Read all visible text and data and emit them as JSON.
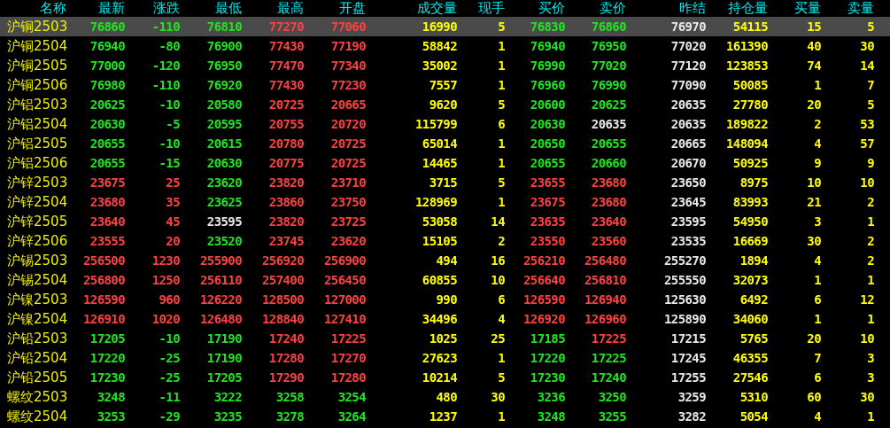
{
  "columns": [
    {
      "label": "名称",
      "kind": "name"
    },
    {
      "label": "最新",
      "kind": "price"
    },
    {
      "label": "涨跌",
      "kind": "price"
    },
    {
      "label": "最低",
      "kind": "price"
    },
    {
      "label": "最高",
      "kind": "price"
    },
    {
      "label": "开盘",
      "kind": "price"
    },
    {
      "label": "成交量",
      "kind": "volume"
    },
    {
      "label": "现手",
      "kind": "volume"
    },
    {
      "label": "买价",
      "kind": "price"
    },
    {
      "label": "卖价",
      "kind": "price"
    },
    {
      "label": "昨结",
      "kind": "settle"
    },
    {
      "label": "持仓量",
      "kind": "volume"
    },
    {
      "label": "买量",
      "kind": "volume"
    },
    {
      "label": "卖量",
      "kind": "volume"
    }
  ],
  "rows": [
    {
      "name": "沪铜2503",
      "selected": true,
      "cells": [
        {
          "text": "76860",
          "rising": false,
          "falling": true
        },
        {
          "text": "-110",
          "rising": false,
          "falling": true
        },
        {
          "text": "76810",
          "rising": false,
          "falling": true
        },
        {
          "text": "77270",
          "rising": true,
          "falling": false
        },
        {
          "text": "77060",
          "rising": true,
          "falling": false
        },
        {
          "text": "16990"
        },
        {
          "text": "5"
        },
        {
          "text": "76830",
          "rising": false,
          "falling": true
        },
        {
          "text": "76860",
          "rising": false,
          "falling": true
        },
        {
          "text": "76970"
        },
        {
          "text": "54115"
        },
        {
          "text": "15"
        },
        {
          "text": "5"
        }
      ]
    },
    {
      "name": "沪铜2504",
      "selected": false,
      "cells": [
        {
          "text": "76940",
          "rising": false,
          "falling": true
        },
        {
          "text": "-80",
          "rising": false,
          "falling": true
        },
        {
          "text": "76900",
          "rising": false,
          "falling": true
        },
        {
          "text": "77430",
          "rising": true,
          "falling": false
        },
        {
          "text": "77190",
          "rising": true,
          "falling": false
        },
        {
          "text": "58842"
        },
        {
          "text": "1"
        },
        {
          "text": "76940",
          "rising": false,
          "falling": true
        },
        {
          "text": "76950",
          "rising": false,
          "falling": true
        },
        {
          "text": "77020"
        },
        {
          "text": "161390"
        },
        {
          "text": "40"
        },
        {
          "text": "30"
        }
      ]
    },
    {
      "name": "沪铜2505",
      "selected": false,
      "cells": [
        {
          "text": "77000",
          "rising": false,
          "falling": true
        },
        {
          "text": "-120",
          "rising": false,
          "falling": true
        },
        {
          "text": "76950",
          "rising": false,
          "falling": true
        },
        {
          "text": "77470",
          "rising": true,
          "falling": false
        },
        {
          "text": "77340",
          "rising": true,
          "falling": false
        },
        {
          "text": "35002"
        },
        {
          "text": "1"
        },
        {
          "text": "76990",
          "rising": false,
          "falling": true
        },
        {
          "text": "77020",
          "rising": false,
          "falling": true
        },
        {
          "text": "77120"
        },
        {
          "text": "123853"
        },
        {
          "text": "74"
        },
        {
          "text": "14"
        }
      ]
    },
    {
      "name": "沪铜2506",
      "selected": false,
      "cells": [
        {
          "text": "76980",
          "rising": false,
          "falling": true
        },
        {
          "text": "-110",
          "rising": false,
          "falling": true
        },
        {
          "text": "76920",
          "rising": false,
          "falling": true
        },
        {
          "text": "77430",
          "rising": true,
          "falling": false
        },
        {
          "text": "77230",
          "rising": true,
          "falling": false
        },
        {
          "text": "7557"
        },
        {
          "text": "1"
        },
        {
          "text": "76960",
          "rising": false,
          "falling": true
        },
        {
          "text": "76990",
          "rising": false,
          "falling": true
        },
        {
          "text": "77090"
        },
        {
          "text": "50085"
        },
        {
          "text": "1"
        },
        {
          "text": "7"
        }
      ]
    },
    {
      "name": "沪铝2503",
      "selected": false,
      "cells": [
        {
          "text": "20625",
          "rising": false,
          "falling": true
        },
        {
          "text": "-10",
          "rising": false,
          "falling": true
        },
        {
          "text": "20580",
          "rising": false,
          "falling": true
        },
        {
          "text": "20725",
          "rising": true,
          "falling": false
        },
        {
          "text": "20665",
          "rising": true,
          "falling": false
        },
        {
          "text": "9620"
        },
        {
          "text": "5"
        },
        {
          "text": "20600",
          "rising": false,
          "falling": true
        },
        {
          "text": "20625",
          "rising": false,
          "falling": true
        },
        {
          "text": "20635"
        },
        {
          "text": "27780"
        },
        {
          "text": "20"
        },
        {
          "text": "5"
        }
      ]
    },
    {
      "name": "沪铝2504",
      "selected": false,
      "cells": [
        {
          "text": "20630",
          "rising": false,
          "falling": true
        },
        {
          "text": "-5",
          "rising": false,
          "falling": true
        },
        {
          "text": "20595",
          "rising": false,
          "falling": true
        },
        {
          "text": "20755",
          "rising": true,
          "falling": false
        },
        {
          "text": "20720",
          "rising": true,
          "falling": false
        },
        {
          "text": "115799"
        },
        {
          "text": "6"
        },
        {
          "text": "20630",
          "rising": false,
          "falling": true
        },
        {
          "text": "20635",
          "rising": false,
          "falling": false
        },
        {
          "text": "20635"
        },
        {
          "text": "189822"
        },
        {
          "text": "2"
        },
        {
          "text": "53"
        }
      ]
    },
    {
      "name": "沪铝2505",
      "selected": false,
      "cells": [
        {
          "text": "20655",
          "rising": false,
          "falling": true
        },
        {
          "text": "-10",
          "rising": false,
          "falling": true
        },
        {
          "text": "20615",
          "rising": false,
          "falling": true
        },
        {
          "text": "20780",
          "rising": true,
          "falling": false
        },
        {
          "text": "20725",
          "rising": true,
          "falling": false
        },
        {
          "text": "65014"
        },
        {
          "text": "1"
        },
        {
          "text": "20650",
          "rising": false,
          "falling": true
        },
        {
          "text": "20655",
          "rising": false,
          "falling": true
        },
        {
          "text": "20665"
        },
        {
          "text": "148094"
        },
        {
          "text": "4"
        },
        {
          "text": "57"
        }
      ]
    },
    {
      "name": "沪铝2506",
      "selected": false,
      "cells": [
        {
          "text": "20655",
          "rising": false,
          "falling": true
        },
        {
          "text": "-15",
          "rising": false,
          "falling": true
        },
        {
          "text": "20630",
          "rising": false,
          "falling": true
        },
        {
          "text": "20775",
          "rising": true,
          "falling": false
        },
        {
          "text": "20725",
          "rising": true,
          "falling": false
        },
        {
          "text": "14465"
        },
        {
          "text": "1"
        },
        {
          "text": "20655",
          "rising": false,
          "falling": true
        },
        {
          "text": "20660",
          "rising": false,
          "falling": true
        },
        {
          "text": "20670"
        },
        {
          "text": "50925"
        },
        {
          "text": "9"
        },
        {
          "text": "9"
        }
      ]
    },
    {
      "name": "沪锌2503",
      "selected": false,
      "cells": [
        {
          "text": "23675",
          "rising": true,
          "falling": false
        },
        {
          "text": "25",
          "rising": true,
          "falling": false
        },
        {
          "text": "23620",
          "rising": false,
          "falling": true
        },
        {
          "text": "23820",
          "rising": true,
          "falling": false
        },
        {
          "text": "23710",
          "rising": true,
          "falling": false
        },
        {
          "text": "3715"
        },
        {
          "text": "5"
        },
        {
          "text": "23655",
          "rising": true,
          "falling": false
        },
        {
          "text": "23680",
          "rising": true,
          "falling": false
        },
        {
          "text": "23650"
        },
        {
          "text": "8975"
        },
        {
          "text": "10"
        },
        {
          "text": "10"
        }
      ]
    },
    {
      "name": "沪锌2504",
      "selected": false,
      "cells": [
        {
          "text": "23680",
          "rising": true,
          "falling": false
        },
        {
          "text": "35",
          "rising": true,
          "falling": false
        },
        {
          "text": "23625",
          "rising": false,
          "falling": true
        },
        {
          "text": "23860",
          "rising": true,
          "falling": false
        },
        {
          "text": "23750",
          "rising": true,
          "falling": false
        },
        {
          "text": "128969"
        },
        {
          "text": "1"
        },
        {
          "text": "23675",
          "rising": true,
          "falling": false
        },
        {
          "text": "23680",
          "rising": true,
          "falling": false
        },
        {
          "text": "23645"
        },
        {
          "text": "83993"
        },
        {
          "text": "21"
        },
        {
          "text": "2"
        }
      ]
    },
    {
      "name": "沪锌2505",
      "selected": false,
      "cells": [
        {
          "text": "23640",
          "rising": true,
          "falling": false
        },
        {
          "text": "45",
          "rising": true,
          "falling": false
        },
        {
          "text": "23595",
          "rising": false,
          "falling": false
        },
        {
          "text": "23820",
          "rising": true,
          "falling": false
        },
        {
          "text": "23725",
          "rising": true,
          "falling": false
        },
        {
          "text": "53058"
        },
        {
          "text": "14"
        },
        {
          "text": "23635",
          "rising": true,
          "falling": false
        },
        {
          "text": "23640",
          "rising": true,
          "falling": false
        },
        {
          "text": "23595"
        },
        {
          "text": "54950"
        },
        {
          "text": "3"
        },
        {
          "text": "1"
        }
      ]
    },
    {
      "name": "沪锌2506",
      "selected": false,
      "cells": [
        {
          "text": "23555",
          "rising": true,
          "falling": false
        },
        {
          "text": "20",
          "rising": true,
          "falling": false
        },
        {
          "text": "23520",
          "rising": false,
          "falling": true
        },
        {
          "text": "23745",
          "rising": true,
          "falling": false
        },
        {
          "text": "23620",
          "rising": true,
          "falling": false
        },
        {
          "text": "15105"
        },
        {
          "text": "2"
        },
        {
          "text": "23550",
          "rising": true,
          "falling": false
        },
        {
          "text": "23560",
          "rising": true,
          "falling": false
        },
        {
          "text": "23535"
        },
        {
          "text": "16669"
        },
        {
          "text": "30"
        },
        {
          "text": "2"
        }
      ]
    },
    {
      "name": "沪锡2503",
      "selected": false,
      "cells": [
        {
          "text": "256500",
          "rising": true,
          "falling": false
        },
        {
          "text": "1230",
          "rising": true,
          "falling": false
        },
        {
          "text": "255900",
          "rising": true,
          "falling": false
        },
        {
          "text": "256920",
          "rising": true,
          "falling": false
        },
        {
          "text": "256900",
          "rising": true,
          "falling": false
        },
        {
          "text": "494"
        },
        {
          "text": "16"
        },
        {
          "text": "256210",
          "rising": true,
          "falling": false
        },
        {
          "text": "256480",
          "rising": true,
          "falling": false
        },
        {
          "text": "255270"
        },
        {
          "text": "1894"
        },
        {
          "text": "4"
        },
        {
          "text": "2"
        }
      ]
    },
    {
      "name": "沪锡2504",
      "selected": false,
      "cells": [
        {
          "text": "256800",
          "rising": true,
          "falling": false
        },
        {
          "text": "1250",
          "rising": true,
          "falling": false
        },
        {
          "text": "256110",
          "rising": true,
          "falling": false
        },
        {
          "text": "257400",
          "rising": true,
          "falling": false
        },
        {
          "text": "256450",
          "rising": true,
          "falling": false
        },
        {
          "text": "60855"
        },
        {
          "text": "10"
        },
        {
          "text": "256640",
          "rising": true,
          "falling": false
        },
        {
          "text": "256810",
          "rising": true,
          "falling": false
        },
        {
          "text": "255550"
        },
        {
          "text": "32073"
        },
        {
          "text": "1"
        },
        {
          "text": "1"
        }
      ]
    },
    {
      "name": "沪镍2503",
      "selected": false,
      "cells": [
        {
          "text": "126590",
          "rising": true,
          "falling": false
        },
        {
          "text": "960",
          "rising": true,
          "falling": false
        },
        {
          "text": "126220",
          "rising": true,
          "falling": false
        },
        {
          "text": "128500",
          "rising": true,
          "falling": false
        },
        {
          "text": "127000",
          "rising": true,
          "falling": false
        },
        {
          "text": "990"
        },
        {
          "text": "6"
        },
        {
          "text": "126590",
          "rising": true,
          "falling": false
        },
        {
          "text": "126940",
          "rising": true,
          "falling": false
        },
        {
          "text": "125630"
        },
        {
          "text": "6492"
        },
        {
          "text": "6"
        },
        {
          "text": "12"
        }
      ]
    },
    {
      "name": "沪镍2504",
      "selected": false,
      "cells": [
        {
          "text": "126910",
          "rising": true,
          "falling": false
        },
        {
          "text": "1020",
          "rising": true,
          "falling": false
        },
        {
          "text": "126480",
          "rising": true,
          "falling": false
        },
        {
          "text": "128840",
          "rising": true,
          "falling": false
        },
        {
          "text": "127410",
          "rising": true,
          "falling": false
        },
        {
          "text": "34496"
        },
        {
          "text": "4"
        },
        {
          "text": "126920",
          "rising": true,
          "falling": false
        },
        {
          "text": "126960",
          "rising": true,
          "falling": false
        },
        {
          "text": "125890"
        },
        {
          "text": "34060"
        },
        {
          "text": "1"
        },
        {
          "text": "1"
        }
      ]
    },
    {
      "name": "沪铅2503",
      "selected": false,
      "cells": [
        {
          "text": "17205",
          "rising": false,
          "falling": true
        },
        {
          "text": "-10",
          "rising": false,
          "falling": true
        },
        {
          "text": "17190",
          "rising": false,
          "falling": true
        },
        {
          "text": "17240",
          "rising": true,
          "falling": false
        },
        {
          "text": "17225",
          "rising": true,
          "falling": false
        },
        {
          "text": "1025"
        },
        {
          "text": "25"
        },
        {
          "text": "17185",
          "rising": false,
          "falling": true
        },
        {
          "text": "17225",
          "rising": true,
          "falling": false
        },
        {
          "text": "17215"
        },
        {
          "text": "5765"
        },
        {
          "text": "20"
        },
        {
          "text": "10"
        }
      ]
    },
    {
      "name": "沪铅2504",
      "selected": false,
      "cells": [
        {
          "text": "17220",
          "rising": false,
          "falling": true
        },
        {
          "text": "-25",
          "rising": false,
          "falling": true
        },
        {
          "text": "17190",
          "rising": false,
          "falling": true
        },
        {
          "text": "17280",
          "rising": true,
          "falling": false
        },
        {
          "text": "17270",
          "rising": true,
          "falling": false
        },
        {
          "text": "27623"
        },
        {
          "text": "1"
        },
        {
          "text": "17220",
          "rising": false,
          "falling": true
        },
        {
          "text": "17225",
          "rising": false,
          "falling": true
        },
        {
          "text": "17245"
        },
        {
          "text": "46355"
        },
        {
          "text": "7"
        },
        {
          "text": "3"
        }
      ]
    },
    {
      "name": "沪铅2505",
      "selected": false,
      "cells": [
        {
          "text": "17230",
          "rising": false,
          "falling": true
        },
        {
          "text": "-25",
          "rising": false,
          "falling": true
        },
        {
          "text": "17205",
          "rising": false,
          "falling": true
        },
        {
          "text": "17290",
          "rising": true,
          "falling": false
        },
        {
          "text": "17280",
          "rising": true,
          "falling": false
        },
        {
          "text": "10214"
        },
        {
          "text": "5"
        },
        {
          "text": "17230",
          "rising": false,
          "falling": true
        },
        {
          "text": "17240",
          "rising": false,
          "falling": true
        },
        {
          "text": "17255"
        },
        {
          "text": "27546"
        },
        {
          "text": "6"
        },
        {
          "text": "3"
        }
      ]
    },
    {
      "name": "螺纹2503",
      "selected": false,
      "cells": [
        {
          "text": "3248",
          "rising": false,
          "falling": true
        },
        {
          "text": "-11",
          "rising": false,
          "falling": true
        },
        {
          "text": "3222",
          "rising": false,
          "falling": true
        },
        {
          "text": "3258",
          "rising": false,
          "falling": true
        },
        {
          "text": "3254",
          "rising": false,
          "falling": true
        },
        {
          "text": "480"
        },
        {
          "text": "30"
        },
        {
          "text": "3236",
          "rising": false,
          "falling": true
        },
        {
          "text": "3250",
          "rising": false,
          "falling": true
        },
        {
          "text": "3259"
        },
        {
          "text": "5310"
        },
        {
          "text": "60"
        },
        {
          "text": "30"
        }
      ]
    },
    {
      "name": "螺纹2504",
      "selected": false,
      "cells": [
        {
          "text": "3253",
          "rising": false,
          "falling": true
        },
        {
          "text": "-29",
          "rising": false,
          "falling": true
        },
        {
          "text": "3235",
          "rising": false,
          "falling": true
        },
        {
          "text": "3278",
          "rising": false,
          "falling": true
        },
        {
          "text": "3264",
          "rising": false,
          "falling": true
        },
        {
          "text": "1237"
        },
        {
          "text": "1"
        },
        {
          "text": "3248",
          "rising": false,
          "falling": true
        },
        {
          "text": "3255",
          "rising": false,
          "falling": true
        },
        {
          "text": "3282"
        },
        {
          "text": "5054"
        },
        {
          "text": "4"
        },
        {
          "text": "1"
        }
      ]
    }
  ]
}
